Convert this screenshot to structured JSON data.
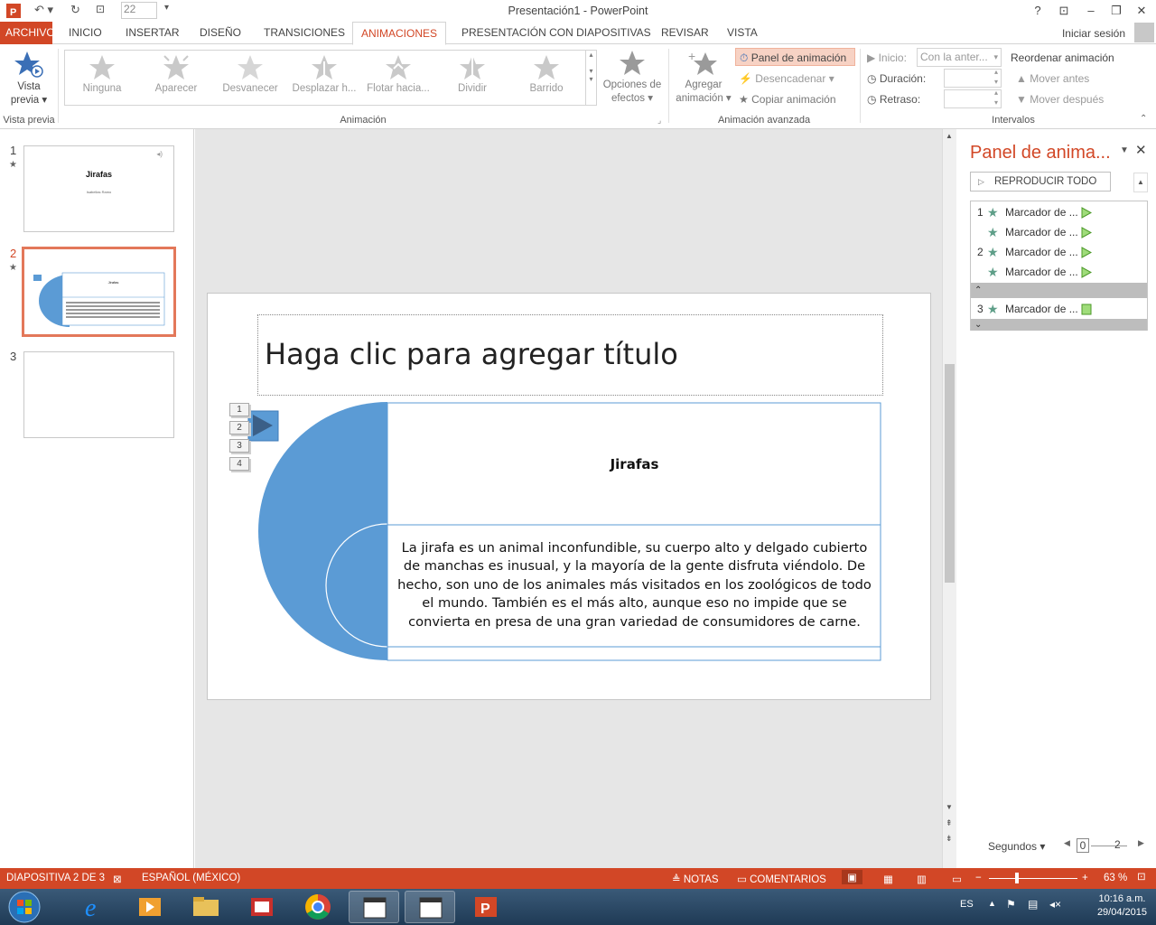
{
  "window": {
    "title": "Presentación1 - PowerPoint",
    "font_size": "22"
  },
  "tabs": [
    "ARCHIVO",
    "INICIO",
    "INSERTAR",
    "DISEÑO",
    "TRANSICIONES",
    "ANIMACIONES",
    "PRESENTACIÓN CON DIAPOSITIVAS",
    "REVISAR",
    "VISTA"
  ],
  "signin": "Iniciar sesión",
  "ribbon": {
    "preview": {
      "line1": "Vista",
      "line2": "previa",
      "group": "Vista previa"
    },
    "gallery": [
      "Ninguna",
      "Aparecer",
      "Desvanecer",
      "Desplazar h...",
      "Flotar hacia...",
      "Dividir",
      "Barrido"
    ],
    "effect_options": {
      "line1": "Opciones de",
      "line2": "efectos"
    },
    "animation_group": "Animación",
    "add_animation": {
      "line1": "Agregar",
      "line2": "animación"
    },
    "animation_pane": "Panel de animación",
    "trigger": "Desencadenar",
    "copy_animation": "Copiar animación",
    "advanced_group": "Animación avanzada",
    "start_label": "Inicio:",
    "start_value": "Con la anter...",
    "duration_label": "Duración:",
    "delay_label": "Retraso:",
    "timing_group": "Intervalos",
    "reorder": "Reordenar animación",
    "move_earlier": "Mover antes",
    "move_later": "Mover después"
  },
  "thumbnails": [
    {
      "num": "1",
      "title": "Jirafas",
      "subtitle": "Isabellas Ramo"
    },
    {
      "num": "2",
      "title": "Jirafas"
    },
    {
      "num": "3"
    }
  ],
  "slide": {
    "title_placeholder": "Haga clic para agregar título",
    "heading": "Jirafas",
    "body": "La jirafa es un animal inconfundible, su cuerpo alto y delgado cubierto de manchas es inusual, y la mayoría de la gente disfruta viéndolo. De hecho, son uno de los animales más visitados en los zoológicos de todo el mundo. También es el más alto, aunque eso  no impide que se convierta en presa de una gran variedad de consumidores de carne.",
    "sequence": [
      "1",
      "2",
      "3",
      "4"
    ]
  },
  "anim_pane": {
    "title": "Panel de anima...",
    "play_all": "REPRODUCIR TODO",
    "items": [
      {
        "num": "1",
        "label": "Marcador de ..."
      },
      {
        "num": "",
        "label": "Marcador de ..."
      },
      {
        "num": "2",
        "label": "Marcador de ..."
      },
      {
        "num": "",
        "label": "Marcador de ..."
      },
      {
        "num": "3",
        "label": "Marcador de ..."
      }
    ],
    "seconds": "Segundos",
    "timeline_start": "0",
    "timeline_end": "2"
  },
  "status": {
    "slide": "DIAPOSITIVA 2 DE 3",
    "language": "ESPAÑOL (MÉXICO)",
    "notes": "NOTAS",
    "comments": "COMENTARIOS",
    "zoom": "63 %"
  },
  "taskbar": {
    "lang": "ES",
    "time": "10:16 a.m.",
    "date": "29/04/2015"
  },
  "colors": {
    "accent": "#d24726",
    "shape_blue": "#5b9bd5",
    "star_green": "#5e9e88"
  }
}
